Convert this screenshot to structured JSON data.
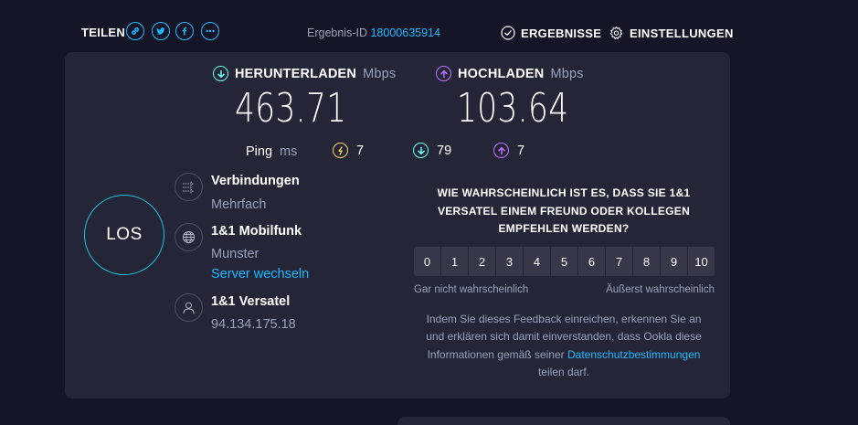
{
  "header": {
    "share_label": "TEILEN",
    "share_icons": [
      "link-icon",
      "twitter-icon",
      "facebook-icon",
      "more-icon"
    ],
    "result_id_label": "Ergebnis-ID",
    "result_id_value": "18000635914",
    "results_label": "ERGEBNISSE",
    "settings_label": "EINSTELLUNGEN"
  },
  "download": {
    "label": "HERUNTERLADEN",
    "unit": "Mbps",
    "value": "463.71"
  },
  "upload": {
    "label": "HOCHLADEN",
    "unit": "Mbps",
    "value": "103.64"
  },
  "ping": {
    "label": "Ping",
    "unit": "ms",
    "idle": "7",
    "download": "79",
    "upload": "7"
  },
  "go_button": {
    "label": "LOS"
  },
  "connections": {
    "title": "Verbindungen",
    "value": "Mehrfach"
  },
  "server": {
    "title": "1&1 Mobilfunk",
    "location": "Munster",
    "change_label": "Server wechseln"
  },
  "isp": {
    "title": "1&1 Versatel",
    "ip": "94.134.175.18"
  },
  "survey": {
    "question": "WIE WAHRSCHEINLICH IST ES, DASS SIE 1&1 VERSATEL EINEM FREUND ODER KOLLEGEN EMPFEHLEN WERDEN?",
    "scale": [
      "0",
      "1",
      "2",
      "3",
      "4",
      "5",
      "6",
      "7",
      "8",
      "9",
      "10"
    ],
    "low_label": "Gar nicht wahrscheinlich",
    "high_label": "Äußerst wahrscheinlich",
    "disclaimer_text": "Indem Sie dieses Feedback einreichen, erkennen Sie an und erklären sich damit einverstanden, dass Ookla diese Informationen gemäß seiner",
    "disclaimer_link": "Datenschutzbestimmungen",
    "disclaimer_tail": "teilen darf."
  },
  "colors": {
    "accent": "#1eb8ff",
    "download": "#6afff3",
    "upload": "#bf71ff",
    "ping": "#fbd55e",
    "go_ring": "#1bc1d6",
    "background": "#141526",
    "panel": "#242638"
  }
}
